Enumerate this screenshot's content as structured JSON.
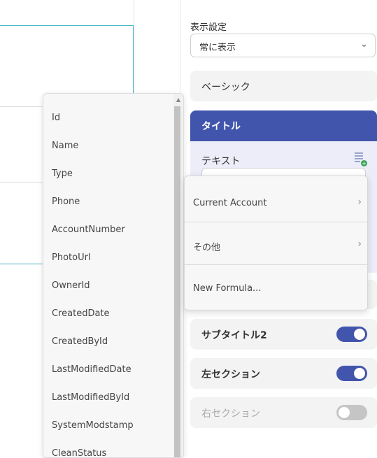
{
  "panel": {
    "display_label": "表示設定",
    "display_select": "常に表示",
    "sections": {
      "basic": "ベーシック",
      "title": "タイトル",
      "text_label": "テキスト",
      "subtitle2": "サブタイトル2",
      "left_section": "左セクション",
      "right_section": "右セクション"
    },
    "toggles": {
      "subtitle2": true,
      "left_section": true,
      "right_section": false
    }
  },
  "field_list": {
    "items": [
      "Id",
      "Name",
      "Type",
      "Phone",
      "AccountNumber",
      "PhotoUrl",
      "OwnerId",
      "CreatedDate",
      "CreatedById",
      "LastModifiedDate",
      "LastModifiedById",
      "SystemModstamp",
      "CleanStatus"
    ]
  },
  "formula_menu": {
    "items": [
      "Current Account",
      "その他",
      "New Formula..."
    ]
  },
  "icons": {
    "select_chevron": "chevron-down-icon",
    "menu_chevron": "chevron-right-icon",
    "formula": "add-formula-icon"
  },
  "colors": {
    "accent": "#4155ac",
    "canvas_border": "#4fb6c6"
  }
}
